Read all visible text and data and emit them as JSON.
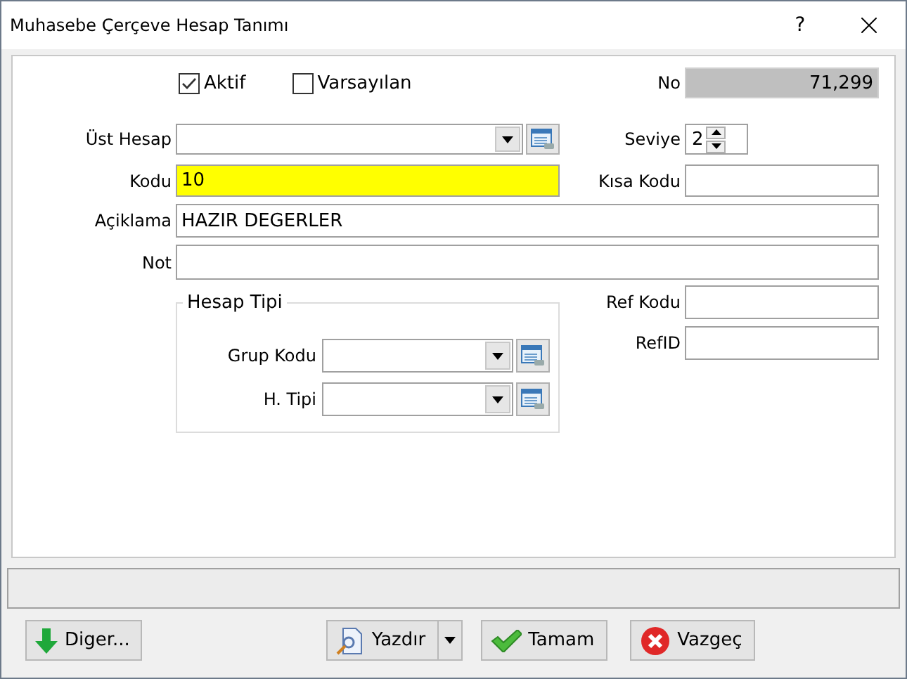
{
  "window": {
    "title": "Muhasebe Çerçeve Hesap Tanımı",
    "help": "?"
  },
  "checkboxes": [
    {
      "label": "Aktif",
      "checked": true
    },
    {
      "label": "Varsayılan",
      "checked": false
    }
  ],
  "no": {
    "label": "No",
    "value": "71,299"
  },
  "ust_hesap": {
    "label": "Üst Hesap"
  },
  "seviye": {
    "label": "Seviye",
    "value": "2"
  },
  "kodu": {
    "label": "Kodu",
    "value": "10",
    "highlighted": true
  },
  "kisa_kodu": {
    "label": "Kısa Kodu"
  },
  "aciklama": {
    "label": "Açiklama",
    "value": "HAZIR DEGERLER"
  },
  "not": {
    "label": "Not"
  },
  "hesap_tipi": {
    "title": "Hesap Tipi",
    "fields": [
      {
        "label": "Grup Kodu"
      },
      {
        "label": "H. Tipi"
      }
    ]
  },
  "ref_kodu": {
    "label": "Ref Kodu"
  },
  "ref_id": {
    "label": "RefID"
  },
  "buttons": [
    {
      "label": "Diger...",
      "kind": "more"
    },
    {
      "label": "Yazdır",
      "kind": "print"
    },
    {
      "label": "Tamam",
      "kind": "ok"
    },
    {
      "label": "Vazgeç",
      "kind": "cancel"
    }
  ]
}
